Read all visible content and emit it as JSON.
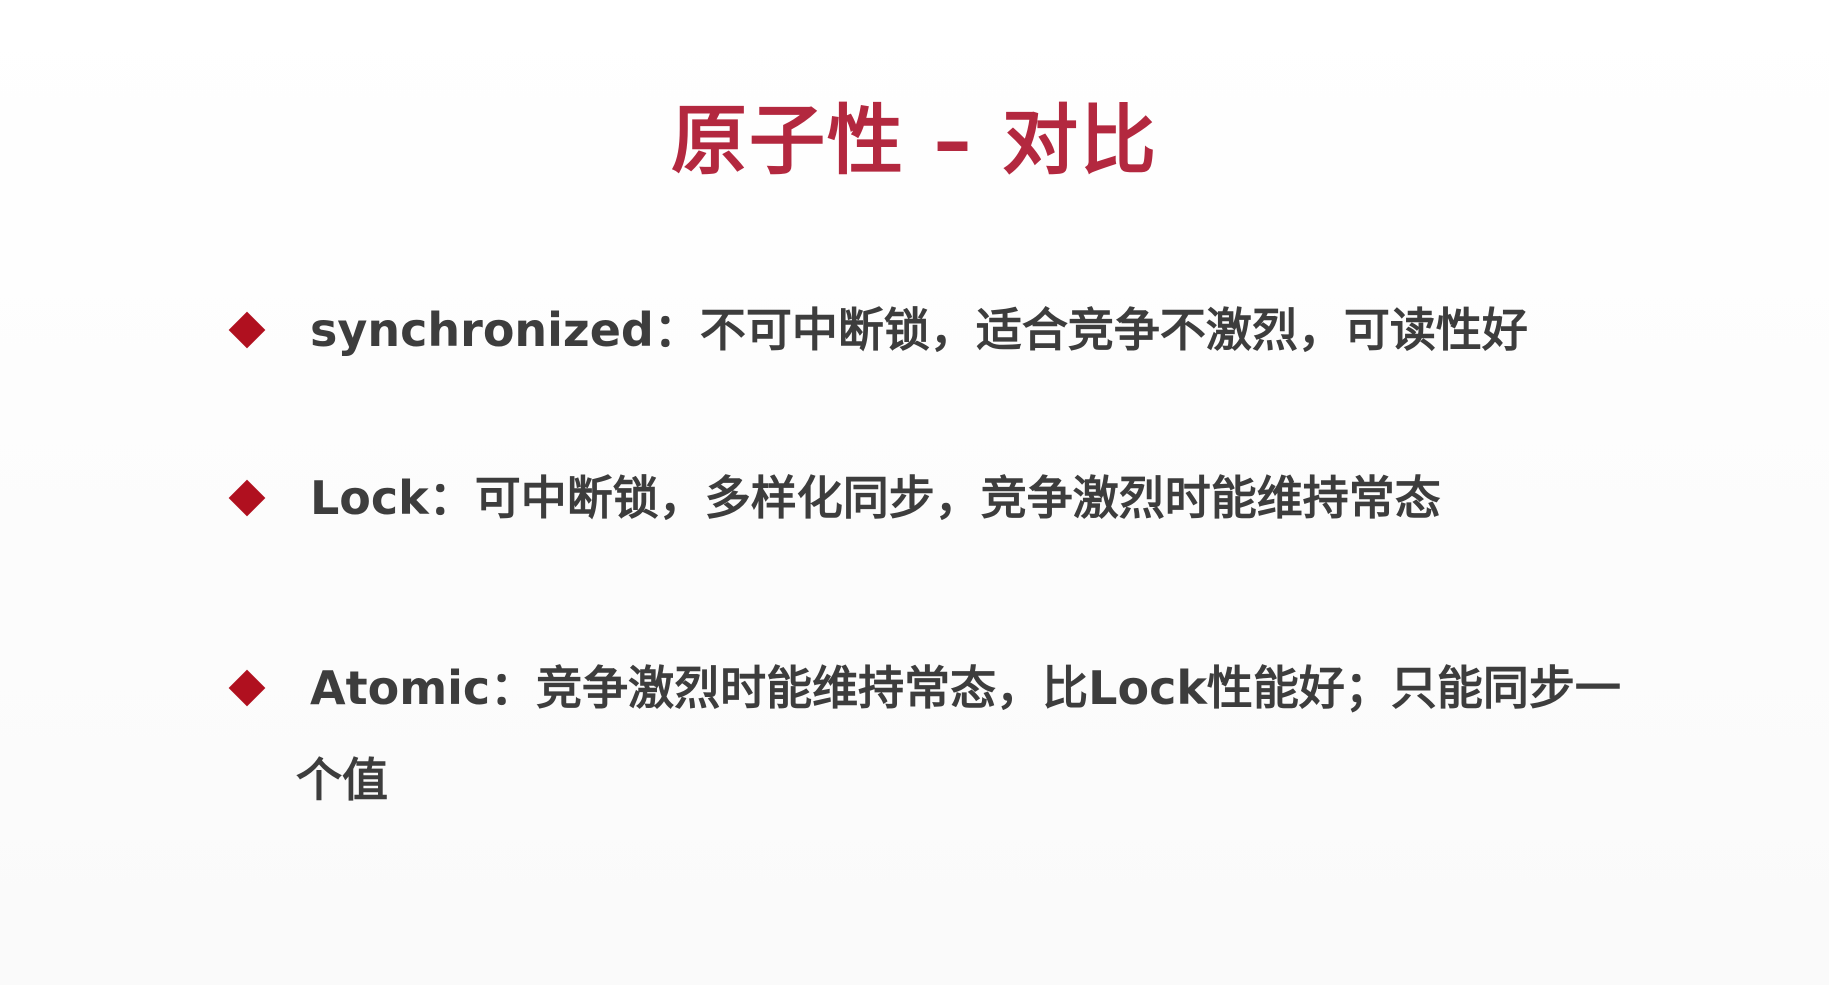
{
  "slide": {
    "title": "原子性 – 对比",
    "bullets": [
      {
        "text": "synchronized：不可中断锁，适合竞争不激烈，可读性好"
      },
      {
        "text": "Lock：可中断锁，多样化同步，竞争激烈时能维持常态"
      },
      {
        "text": "Atomic：竞争激烈时能维持常态，比Lock性能好；只能同步一",
        "continuation": "个值"
      }
    ]
  },
  "colors": {
    "title": "#b3283f",
    "bullet_marker": "#b0101f",
    "body_text": "#3d3d3d",
    "background": "#fdfdfd"
  },
  "icons": {
    "bullet_marker": "diamond-icon"
  }
}
